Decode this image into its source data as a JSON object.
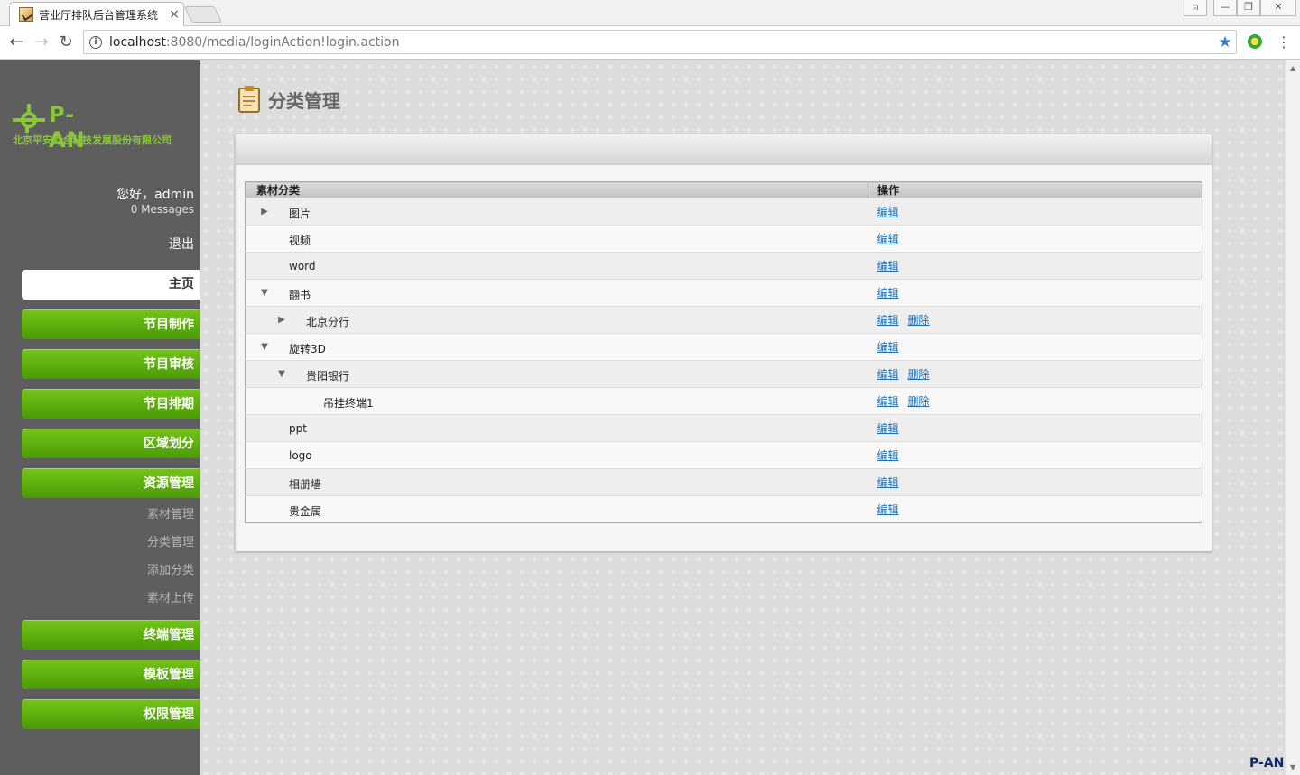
{
  "browser": {
    "tab_title": "营业厅排队后台管理系统",
    "tab_close": "×",
    "url_host": "localhost",
    "url_rest": ":8080/media/loginAction!login.action",
    "back": "←",
    "forward": "→",
    "reload": "↻",
    "star": "★",
    "menu": "⋮",
    "win_user": "⍝",
    "win_min": "—",
    "win_restore": "❐",
    "win_close": "✕"
  },
  "logo": {
    "text": "P-AN",
    "subtitle": "北京平安力合科技发展股份有限公司"
  },
  "user": {
    "greeting": "您好，admin",
    "messages": "0 Messages",
    "logout": "退出"
  },
  "nav": {
    "home": "主页",
    "items": [
      "节目制作",
      "节目审核",
      "节目排期",
      "区域划分",
      "资源管理"
    ],
    "sub_items": [
      "素材管理",
      "分类管理",
      "添加分类",
      "素材上传"
    ],
    "lower_items": [
      "终端管理",
      "模板管理",
      "权限管理"
    ]
  },
  "page": {
    "title": "分类管理"
  },
  "table": {
    "headers": [
      "素材分类",
      "操作"
    ],
    "rows": [
      {
        "name": "图片",
        "toggle": "▶",
        "depth": 0,
        "actions": [
          "编辑"
        ]
      },
      {
        "name": "视频",
        "toggle": "",
        "depth": 0,
        "actions": [
          "编辑"
        ]
      },
      {
        "name": "word",
        "toggle": "",
        "depth": 0,
        "actions": [
          "编辑"
        ]
      },
      {
        "name": "翻书",
        "toggle": "▼",
        "depth": 0,
        "actions": [
          "编辑"
        ]
      },
      {
        "name": "北京分行",
        "toggle": "▶",
        "depth": 1,
        "actions": [
          "编辑",
          "删除"
        ]
      },
      {
        "name": "旋转3D",
        "toggle": "▼",
        "depth": 0,
        "actions": [
          "编辑"
        ]
      },
      {
        "name": "贵阳银行",
        "toggle": "▼",
        "depth": 1,
        "actions": [
          "编辑",
          "删除"
        ]
      },
      {
        "name": "吊挂终端1",
        "toggle": "",
        "depth": 2,
        "actions": [
          "编辑",
          "删除"
        ]
      },
      {
        "name": "ppt",
        "toggle": "",
        "depth": 0,
        "actions": [
          "编辑"
        ]
      },
      {
        "name": "logo",
        "toggle": "",
        "depth": 0,
        "actions": [
          "编辑"
        ]
      },
      {
        "name": "相册墙",
        "toggle": "",
        "depth": 0,
        "actions": [
          "编辑"
        ]
      },
      {
        "name": "贵金属",
        "toggle": "",
        "depth": 0,
        "actions": [
          "编辑"
        ]
      }
    ]
  },
  "footer_logo": "P-AN",
  "colors": {
    "accent_green": "#5fb10f",
    "logo_green": "#8cc63e",
    "sidebar_bg": "#5e5e5e",
    "link": "#1e6fb0"
  }
}
